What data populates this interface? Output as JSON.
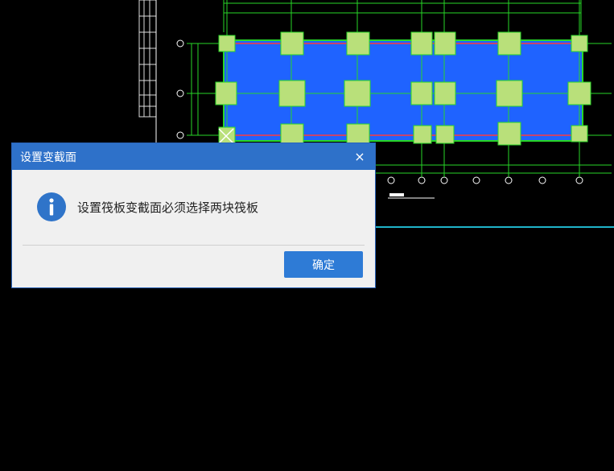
{
  "dialog": {
    "title": "设置变截面",
    "message": "设置筏板变截面必须选择两块筏板",
    "ok_label": "确定",
    "close_glyph": "×"
  },
  "colors": {
    "title_bar": "#2e71c9",
    "button": "#2e7bd6",
    "dialog_bg": "#f0f0f0",
    "cad_background": "#000000",
    "raft_fill": "#1f63ff",
    "pile_cap": "#b9e07a",
    "grid_line": "#27d627"
  },
  "icons": {
    "info": "info-icon",
    "close": "close-icon"
  }
}
